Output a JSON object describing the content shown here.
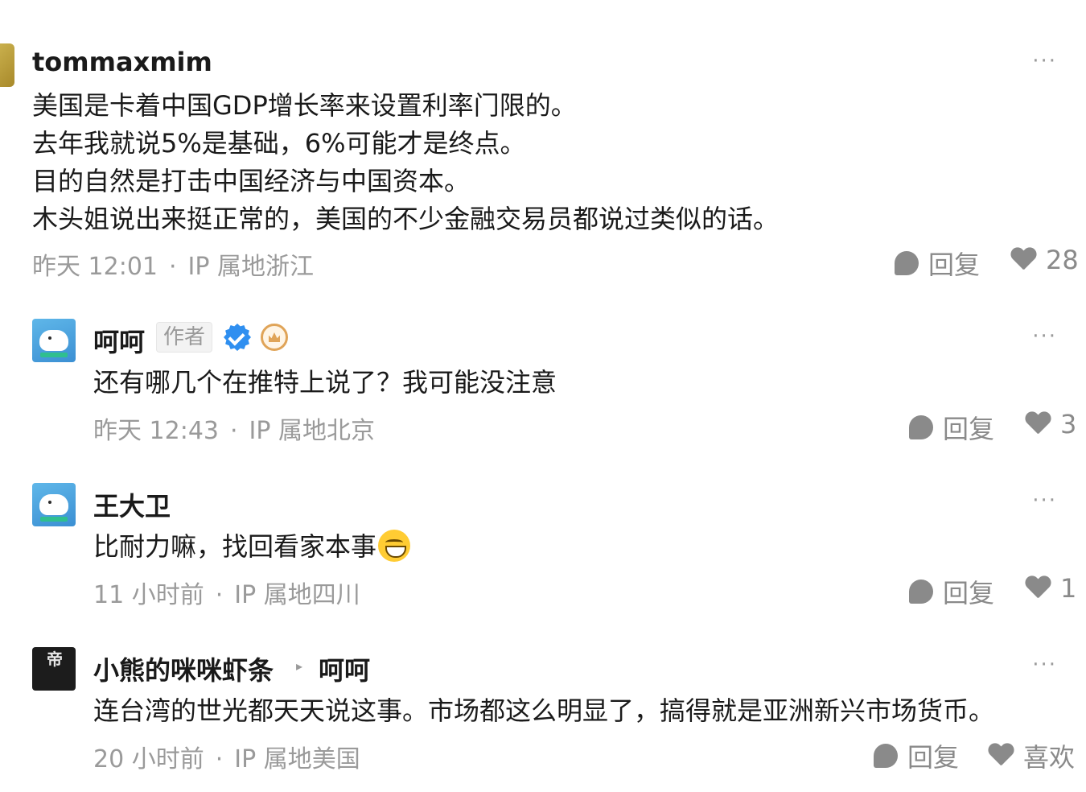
{
  "comments": [
    {
      "username": "tommaxmim",
      "lines": "美国是卡着中国GDP增长率来设置利率门限的。\n去年我就说5%是基础，6%可能才是终点。\n目的自然是打击中国经济与中国资本。\n木头姐说出来挺正常的，美国的不少金融交易员都说过类似的话。",
      "time": "昨天 12:01",
      "location": "IP 属地浙江",
      "reply_label": "回复",
      "likes": "28"
    },
    {
      "username": "呵呵",
      "author_tag": "作者",
      "text": "还有哪几个在推特上说了？我可能没注意",
      "time": "昨天 12:43",
      "location": "IP 属地北京",
      "reply_label": "回复",
      "likes": "3"
    },
    {
      "username": "王大卫",
      "text": "比耐力嘛，找回看家本事",
      "time": "11 小时前",
      "location": "IP 属地四川",
      "reply_label": "回复",
      "likes": "1"
    },
    {
      "username": "小熊的咪咪虾条",
      "reply_to": "呵呵",
      "text": "连台湾的世光都天天说这事。市场都这么明显了，搞得就是亚洲新兴市场货币。",
      "time": "20 小时前",
      "location": "IP 属地美国",
      "reply_label": "回复",
      "likes": "喜欢"
    }
  ],
  "separator": "·",
  "more_label": "···",
  "avatar_glyph": "帝",
  "icons": {
    "more": "more-icon",
    "reply": "reply-icon",
    "like": "heart-icon",
    "verified": "verified-icon",
    "badge": "badge-icon",
    "emoji": "grinning-emoji-icon"
  }
}
